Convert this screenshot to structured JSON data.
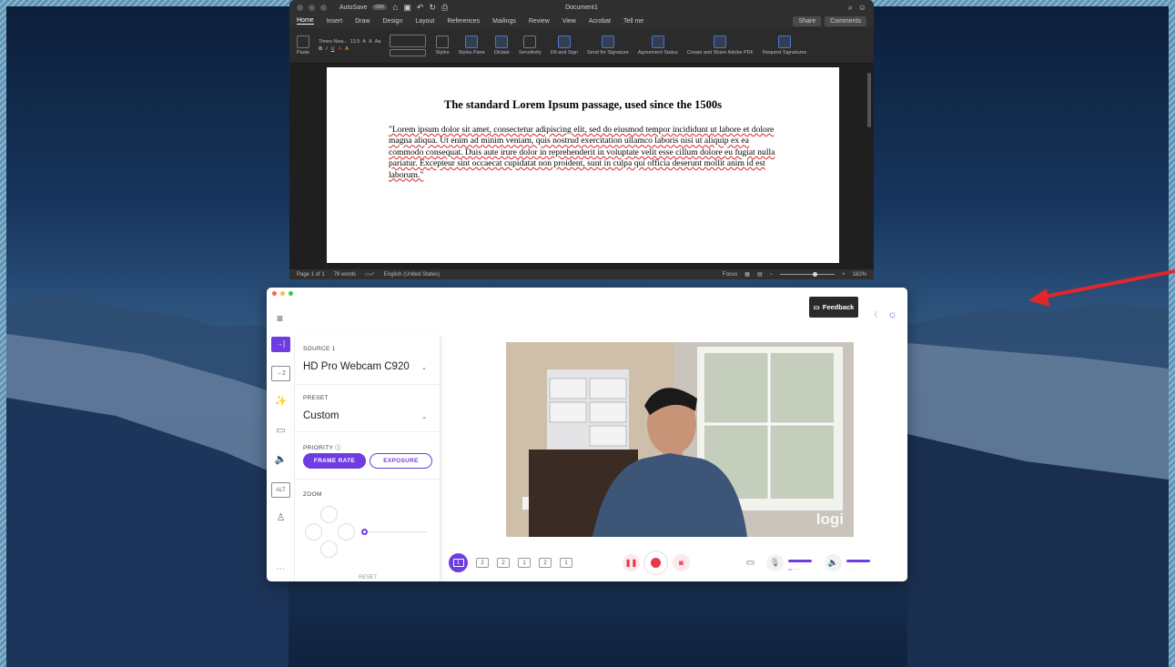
{
  "word": {
    "autosave": "AutoSave",
    "autosave_state": "OFF",
    "title": "Document1",
    "tabs": [
      "Home",
      "Insert",
      "Draw",
      "Design",
      "Layout",
      "References",
      "Mailings",
      "Review",
      "View",
      "Acrobat"
    ],
    "tell_me": "Tell me",
    "share": "Share",
    "comments": "Comments",
    "paste": "Paste",
    "font_name": "Times New...",
    "font_size": "13.5",
    "ribbon_groups": [
      "Styles",
      "Styles Pane",
      "Dictate",
      "Sensitivity",
      "Fill and Sign",
      "Send for Signature",
      "Agreement Status",
      "Create and Share Adobe PDF",
      "Request Signatures"
    ],
    "doc_heading": "The standard Lorem Ipsum passage, used since the 1500s",
    "doc_body": "\"Lorem ipsum dolor sit amet, consectetur adipiscing elit, sed do eiusmod tempor incididunt ut labore et dolore magna aliqua. Ut enim ad minim veniam, quis nostrud exercitation ullamco laboris nisi ut aliquip ex ea commodo consequat. Duis aute irure dolor in reprehenderit in voluptate velit esse cillum dolore eu fugiat nulla pariatur. Excepteur sint occaecat cupidatat non proident, sunt in culpa qui officia deserunt mollit anim id est laborum.\"",
    "status_page": "Page 1 of 1",
    "status_words": "78 words",
    "status_language": "English (United States)",
    "status_focus": "Focus",
    "zoom": "182%"
  },
  "logi": {
    "feedback": "Feedback",
    "source_label": "SOURCE 1",
    "source_value": "HD Pro Webcam C920",
    "preset_label": "PRESET",
    "preset_value": "Custom",
    "priority_label": "PRIORITY",
    "frame_rate": "FRAME RATE",
    "exposure": "EXPOSURE",
    "zoom_label": "ZOOM",
    "reset": "RESET",
    "watermark": "logi",
    "rail_items": [
      "source-1",
      "source-2",
      "effects",
      "camera",
      "audio",
      "alt",
      "profile"
    ],
    "alt_label": "ALT",
    "layout_buttons": [
      "1",
      "2",
      "2",
      "1",
      "2",
      "1"
    ],
    "mic_level": 0.8,
    "volume_level": 0.85
  },
  "colors": {
    "accent": "#6e3ce3",
    "record": "#e8374a",
    "arrow": "#e3262b"
  }
}
